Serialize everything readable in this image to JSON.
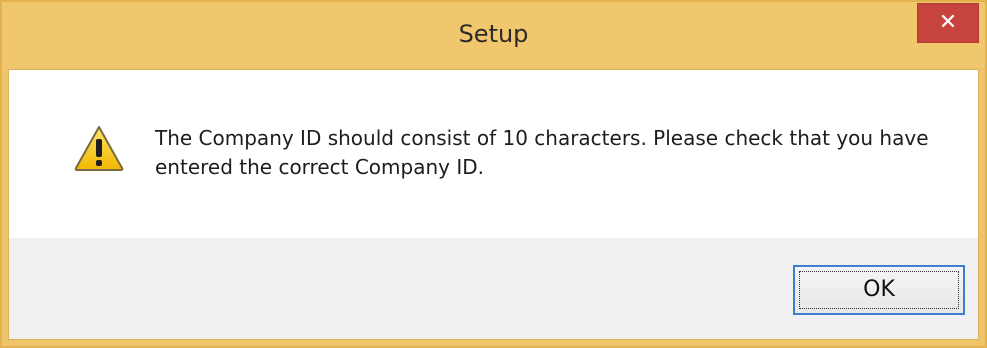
{
  "dialog": {
    "title": "Setup",
    "close_symbol": "✕",
    "icon": "warning-icon",
    "message": "The Company ID should consist of 10 characters. Please check that you have entered the correct Company ID.",
    "ok_label": "OK",
    "colors": {
      "titlebar": "#f1c76d",
      "close_button": "#c7443e",
      "footer": "#f0f0f0",
      "ok_border": "#3c7fd1"
    }
  }
}
